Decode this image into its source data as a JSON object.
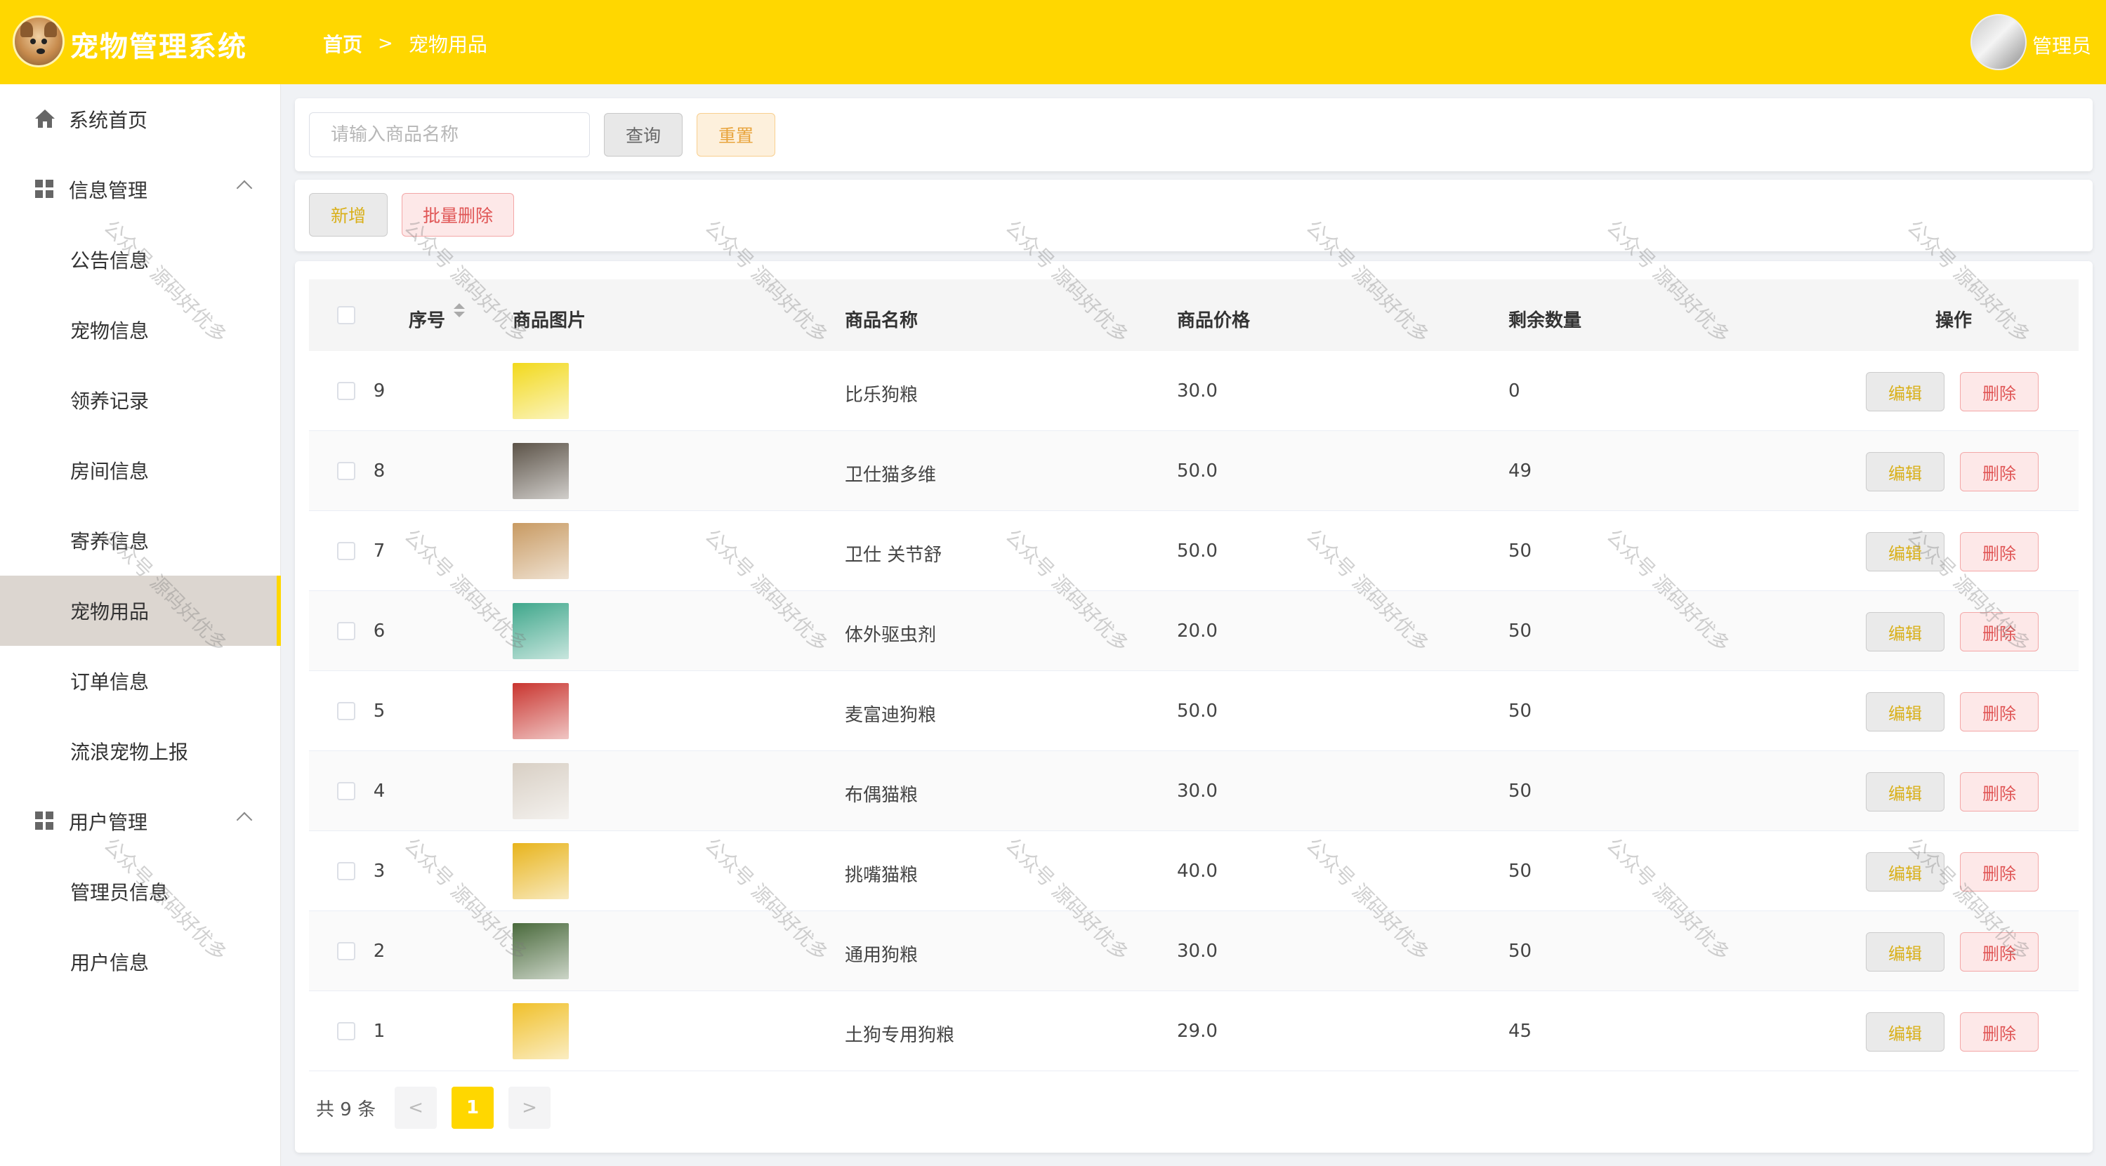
{
  "header": {
    "app_title": "宠物管理系统",
    "breadcrumb_home": "首页",
    "breadcrumb_sep": ">",
    "breadcrumb_current": "宠物用品",
    "user_name": "管理员"
  },
  "sidebar": {
    "items": [
      {
        "label": "系统首页",
        "type": "top"
      },
      {
        "label": "信息管理",
        "type": "group"
      },
      {
        "label": "公告信息",
        "type": "sub"
      },
      {
        "label": "宠物信息",
        "type": "sub"
      },
      {
        "label": "领养记录",
        "type": "sub"
      },
      {
        "label": "房间信息",
        "type": "sub"
      },
      {
        "label": "寄养信息",
        "type": "sub"
      },
      {
        "label": "宠物用品",
        "type": "sub",
        "active": true
      },
      {
        "label": "订单信息",
        "type": "sub"
      },
      {
        "label": "流浪宠物上报",
        "type": "sub"
      },
      {
        "label": "用户管理",
        "type": "group"
      },
      {
        "label": "管理员信息",
        "type": "sub"
      },
      {
        "label": "用户信息",
        "type": "sub"
      }
    ]
  },
  "search": {
    "placeholder": "请输入商品名称",
    "value": "",
    "query_label": "查询",
    "reset_label": "重置"
  },
  "toolbar": {
    "add_label": "新增",
    "batch_delete_label": "批量删除"
  },
  "table": {
    "headers": {
      "index": "序号",
      "image": "商品图片",
      "name": "商品名称",
      "price": "商品价格",
      "stock": "剩余数量",
      "actions": "操作"
    },
    "edit_label": "编辑",
    "delete_label": "删除",
    "rows": [
      {
        "index": "9",
        "name": "比乐狗粮",
        "price": "30.0",
        "stock": "0",
        "thumb_color": "#f2d91c"
      },
      {
        "index": "8",
        "name": "卫仕猫多维",
        "price": "50.0",
        "stock": "49",
        "thumb_color": "#5c5348"
      },
      {
        "index": "7",
        "name": "卫仕 关节舒",
        "price": "50.0",
        "stock": "50",
        "thumb_color": "#c89a62"
      },
      {
        "index": "6",
        "name": "体外驱虫剂",
        "price": "20.0",
        "stock": "50",
        "thumb_color": "#3fa78b"
      },
      {
        "index": "5",
        "name": "麦富迪狗粮",
        "price": "50.0",
        "stock": "50",
        "thumb_color": "#c9352f"
      },
      {
        "index": "4",
        "name": "布偶猫粮",
        "price": "30.0",
        "stock": "50",
        "thumb_color": "#d8cfc4"
      },
      {
        "index": "3",
        "name": "挑嘴猫粮",
        "price": "40.0",
        "stock": "50",
        "thumb_color": "#e8b41c"
      },
      {
        "index": "2",
        "name": "通用狗粮",
        "price": "30.0",
        "stock": "50",
        "thumb_color": "#4a6a3c"
      },
      {
        "index": "1",
        "name": "土狗专用狗粮",
        "price": "29.0",
        "stock": "45",
        "thumb_color": "#f0c02a"
      }
    ]
  },
  "pagination": {
    "total_text": "共 9 条",
    "prev": "<",
    "next": ">",
    "current": "1"
  },
  "watermark_text": "公众号 源码好优多",
  "colors": {
    "accent": "#ffd700",
    "danger": "#e05555",
    "active_menu_bg": "#dcd6d0"
  }
}
